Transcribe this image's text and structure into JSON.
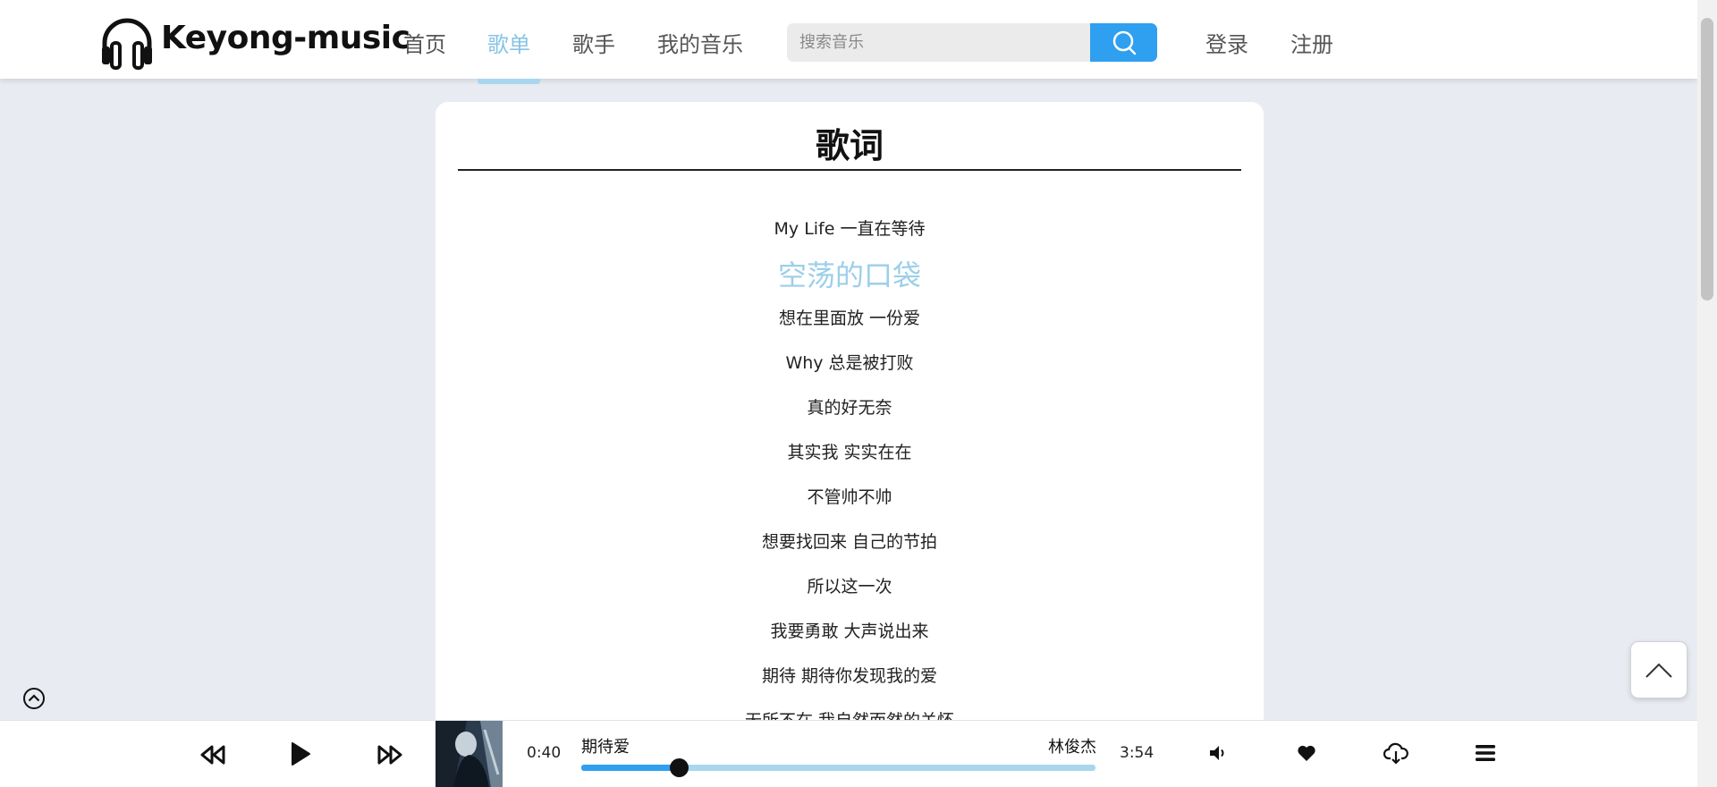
{
  "header": {
    "brand": "Keyong-music",
    "nav": [
      "首页",
      "歌单",
      "歌手",
      "我的音乐"
    ],
    "active_nav": "歌单",
    "search_placeholder": "搜索音乐",
    "login": "登录",
    "register": "注册"
  },
  "lyrics": {
    "title": "歌词",
    "lines": [
      "My Life 一直在等待",
      "空荡的口袋",
      "想在里面放 一份爱",
      "Why 总是被打败",
      "真的好无奈",
      "其实我 实实在在",
      "不管帅不帅",
      "想要找回来 自己的节拍",
      "所以这一次",
      "我要勇敢 大声说出来",
      "期待 期待你发现我的爱",
      "无所不在 我自然而然的关怀"
    ],
    "current_line": "空荡的口袋"
  },
  "player": {
    "song": "期待爱",
    "artist": "林俊杰",
    "current_time": "0:40",
    "total_time": "3:54",
    "progress": 0.19
  },
  "icons": {
    "logo": "headphones-icon",
    "search": "search-icon",
    "back_to_top": "chevron-up-icon",
    "collapse": "circle-chevron-up-icon",
    "prev": "rewind-icon",
    "play": "play-icon",
    "next": "fast-forward-icon",
    "volume": "volume-icon",
    "like": "heart-icon",
    "download": "cloud-download-icon",
    "playlist": "menu-icon"
  },
  "colors": {
    "accent": "#2f9ff0",
    "active_nav": "#86c4e6",
    "current_lyric": "#9ccfe9",
    "progress_track": "#a9d6ef",
    "background": "#e8ecf2"
  }
}
